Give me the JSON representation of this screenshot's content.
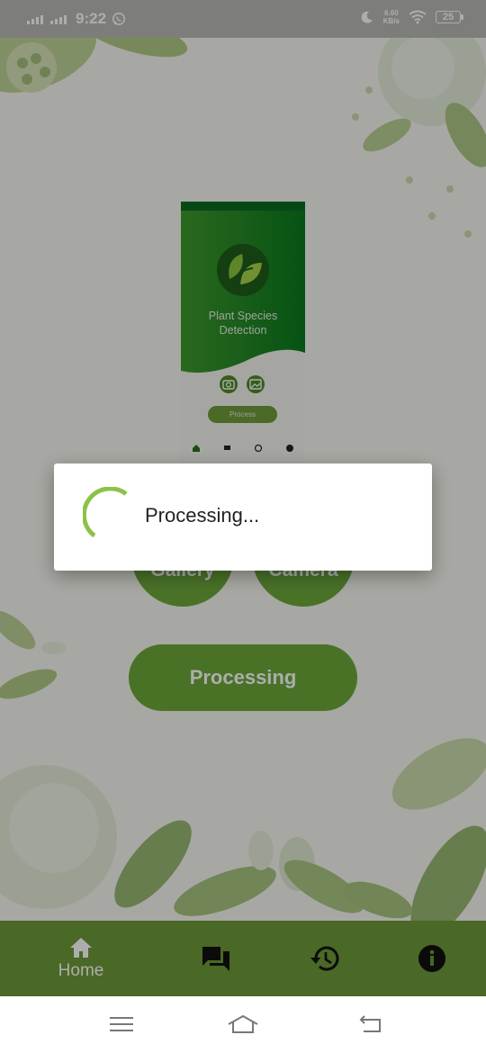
{
  "status_bar": {
    "time": "9:22",
    "net_speed_value": "6.60",
    "net_speed_unit": "KB/s",
    "battery": "25"
  },
  "preview": {
    "title_line1": "Plant Species",
    "title_line2": "Detection",
    "process_label": "Process"
  },
  "main": {
    "gallery_label": "Gallery",
    "camera_label": "Camera",
    "process_button_label": "Processing"
  },
  "bottom_nav": {
    "home_label": "Home"
  },
  "dialog": {
    "message": "Processing..."
  },
  "colors": {
    "accent_green": "#6d9a38",
    "spinner_green": "#8bc34a",
    "dark_green": "#0d6a22"
  }
}
